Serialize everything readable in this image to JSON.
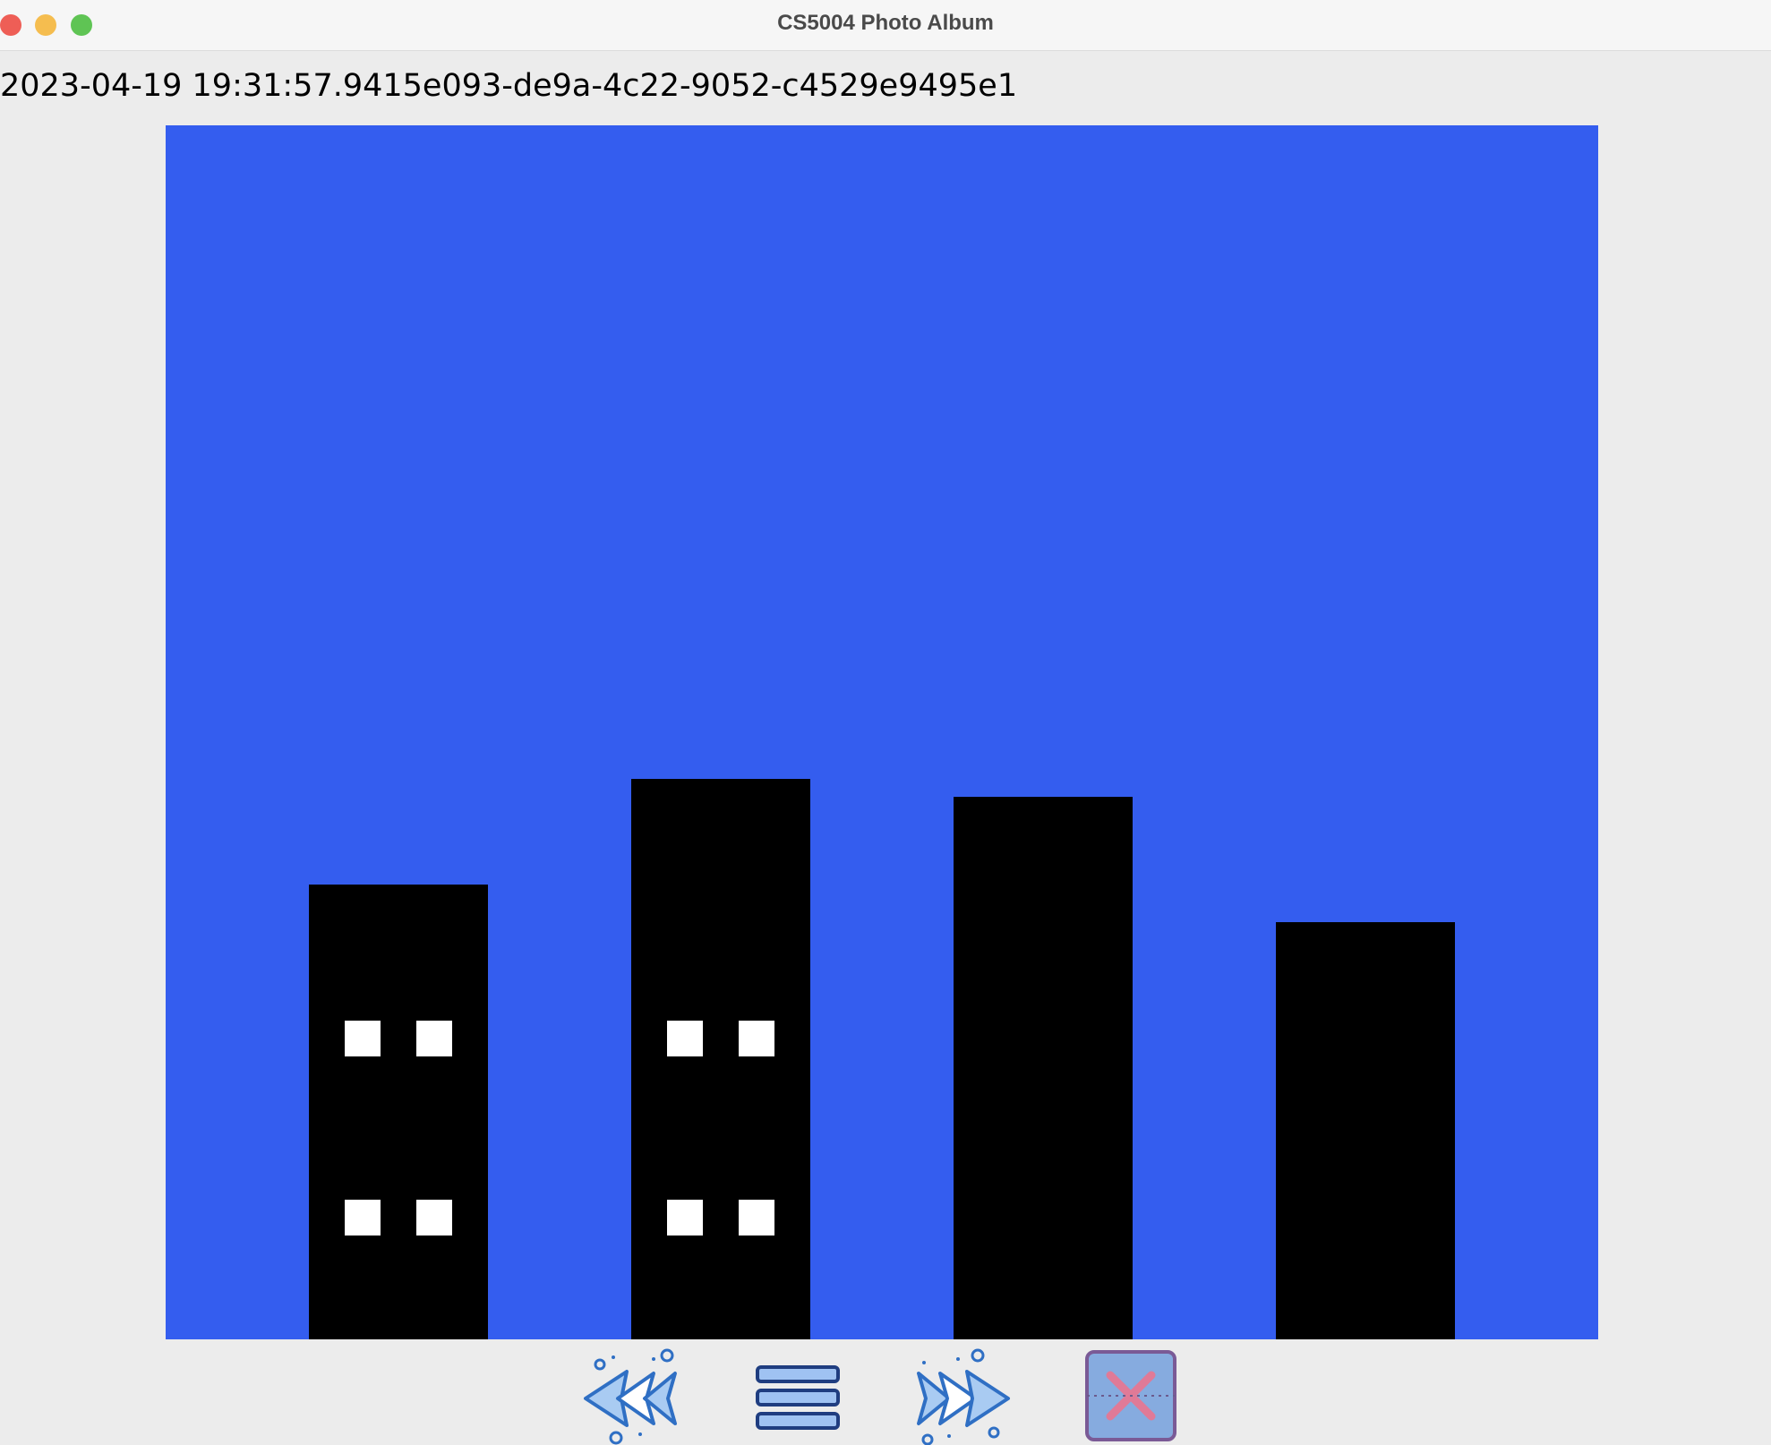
{
  "window": {
    "title": "CS5004 Photo Album"
  },
  "snapshot": {
    "label": "2023-04-19 19:31:57.9415e093-de9a-4c22-9052-c4529e9495e1"
  },
  "colors": {
    "sky": "#345def",
    "building": "#000000",
    "window": "#ffffff"
  },
  "controls": [
    {
      "name": "previous-button",
      "icon": "rewind-icon"
    },
    {
      "name": "menu-button",
      "icon": "list-menu-icon"
    },
    {
      "name": "next-button",
      "icon": "fast-forward-icon"
    },
    {
      "name": "exit-button",
      "icon": "close-x-icon"
    }
  ]
}
